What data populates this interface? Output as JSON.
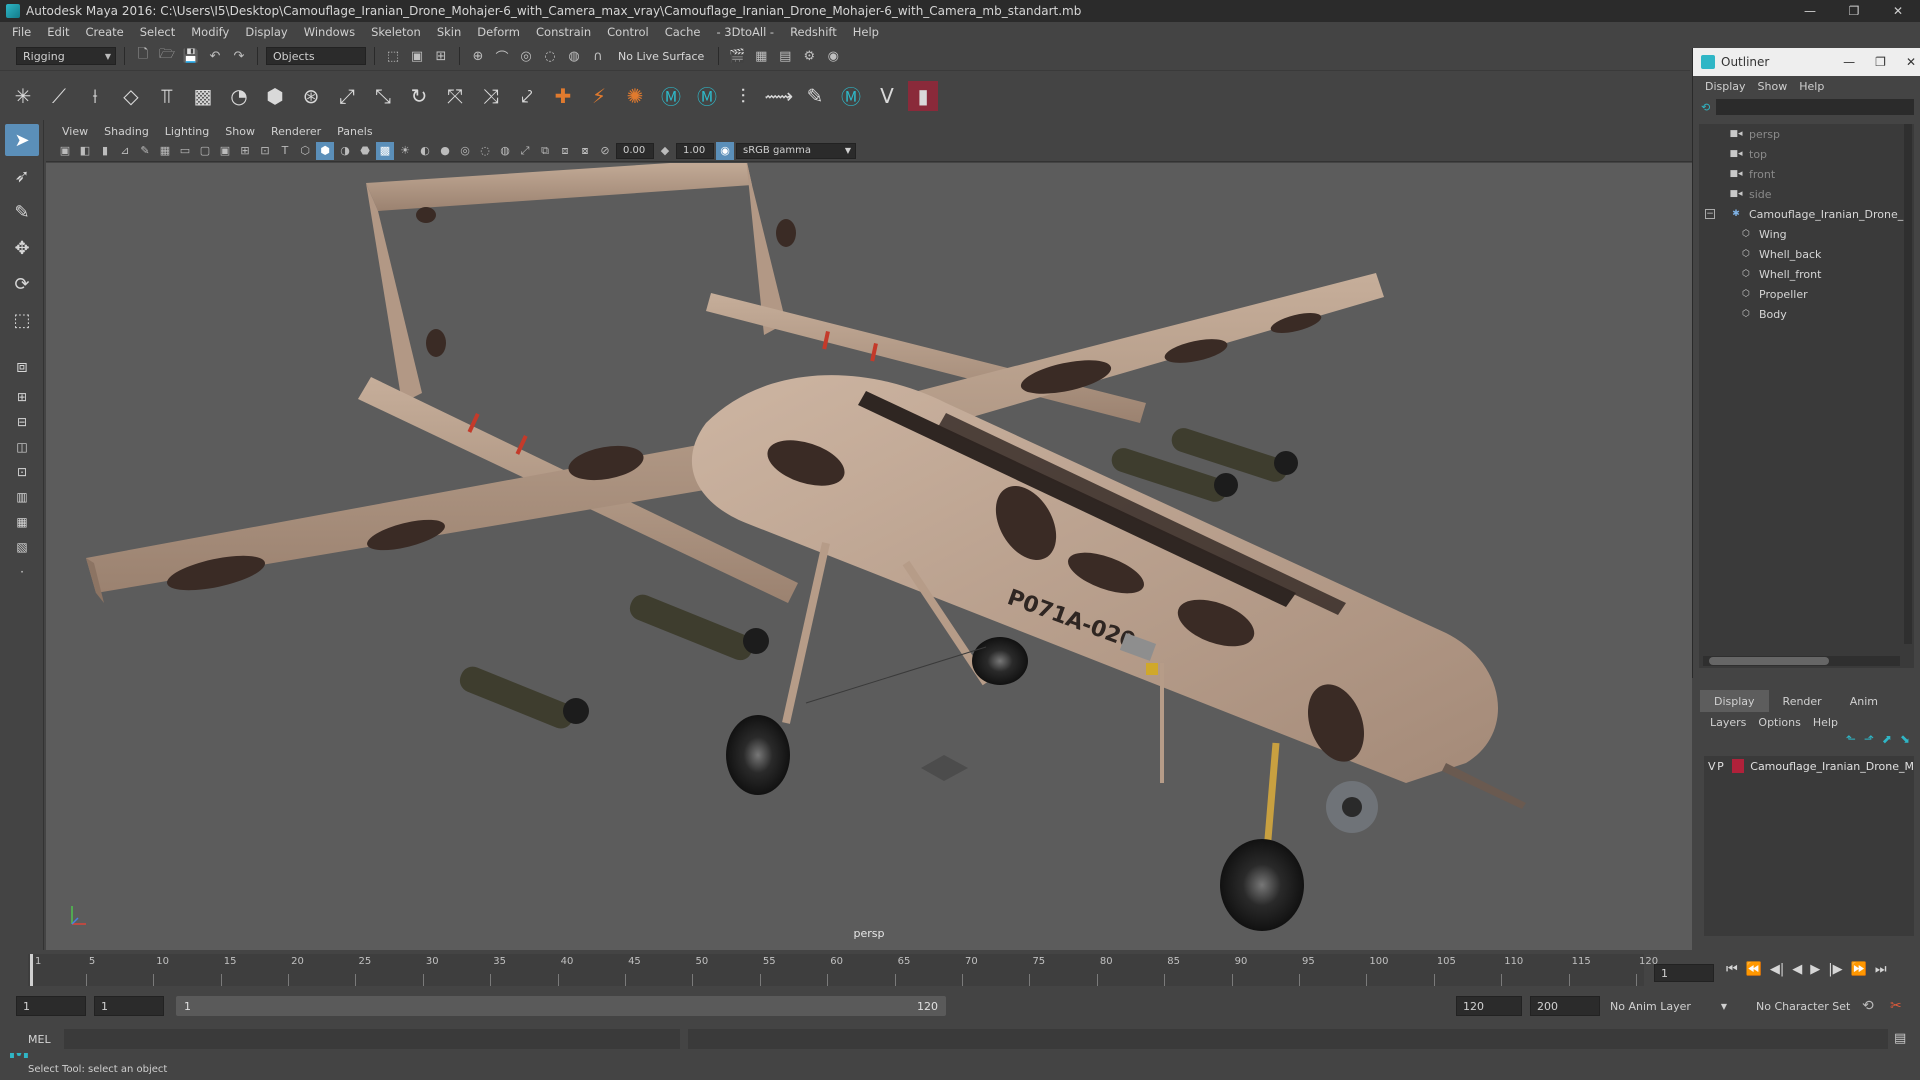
{
  "window": {
    "title": "Autodesk Maya 2016: C:\\Users\\I5\\Desktop\\Camouflage_Iranian_Drone_Mohajer-6_with_Camera_max_vray\\Camouflage_Iranian_Drone_Mohajer-6_with_Camera_mb_standart.mb",
    "minimize": "—",
    "restore": "❐",
    "close": "✕"
  },
  "menus": [
    "File",
    "Edit",
    "Create",
    "Select",
    "Modify",
    "Display",
    "Windows",
    "Skeleton",
    "Skin",
    "Deform",
    "Constrain",
    "Control",
    "Cache",
    "- 3DtoAll -",
    "Redshift",
    "Help"
  ],
  "status": {
    "mode": "Rigging",
    "selection_mode": "Objects",
    "live_surface": "No Live Surface"
  },
  "viewport": {
    "menus": [
      "View",
      "Shading",
      "Lighting",
      "Show",
      "Renderer",
      "Panels"
    ],
    "exposure": "0.00",
    "gamma_value": "1.00",
    "color_space": "sRGB gamma",
    "camera": "persp",
    "tail_number": "P071A-020"
  },
  "outliner": {
    "title": "Outliner",
    "menus": [
      "Display",
      "Show",
      "Help"
    ],
    "items": [
      {
        "label": "persp",
        "kind": "camera",
        "level": 0
      },
      {
        "label": "top",
        "kind": "camera",
        "level": 0
      },
      {
        "label": "front",
        "kind": "camera",
        "level": 0
      },
      {
        "label": "side",
        "kind": "camera",
        "level": 0
      },
      {
        "label": "Camouflage_Iranian_Drone_M",
        "kind": "group",
        "level": 0
      },
      {
        "label": "Wing",
        "kind": "mesh",
        "level": 1
      },
      {
        "label": "Whell_back",
        "kind": "mesh",
        "level": 1
      },
      {
        "label": "Whell_front",
        "kind": "mesh",
        "level": 1
      },
      {
        "label": "Propeller",
        "kind": "mesh",
        "level": 1
      },
      {
        "label": "Body",
        "kind": "mesh",
        "level": 1
      }
    ]
  },
  "layers": {
    "tabs": [
      "Display",
      "Render",
      "Anim"
    ],
    "menus": [
      "Layers",
      "Options",
      "Help"
    ],
    "rows": [
      {
        "v": "V",
        "p": "P",
        "name": "Camouflage_Iranian_Drone_M",
        "color": "#b0213a"
      }
    ]
  },
  "timeline": {
    "ticks": [
      "1",
      "5",
      "10",
      "15",
      "20",
      "25",
      "30",
      "35",
      "40",
      "45",
      "50",
      "55",
      "60",
      "65",
      "70",
      "75",
      "80",
      "85",
      "90",
      "95",
      "100",
      "105",
      "110",
      "115",
      "120"
    ],
    "current_frame": "1"
  },
  "range": {
    "start": "1",
    "playback_start": "1",
    "bar_start": "1",
    "bar_end": "120",
    "playback_end": "120",
    "end": "200",
    "anim_layer": "No Anim Layer",
    "character_set": "No Character Set"
  },
  "command": {
    "label": "MEL"
  },
  "help_line": "Select Tool: select an object",
  "colors": {
    "accent": "#5b8fb9",
    "maya_teal": "#2fb6c6",
    "layer_red": "#b0213a",
    "drone_tan": "#b39a86",
    "camo_dark": "#3a2b25"
  }
}
